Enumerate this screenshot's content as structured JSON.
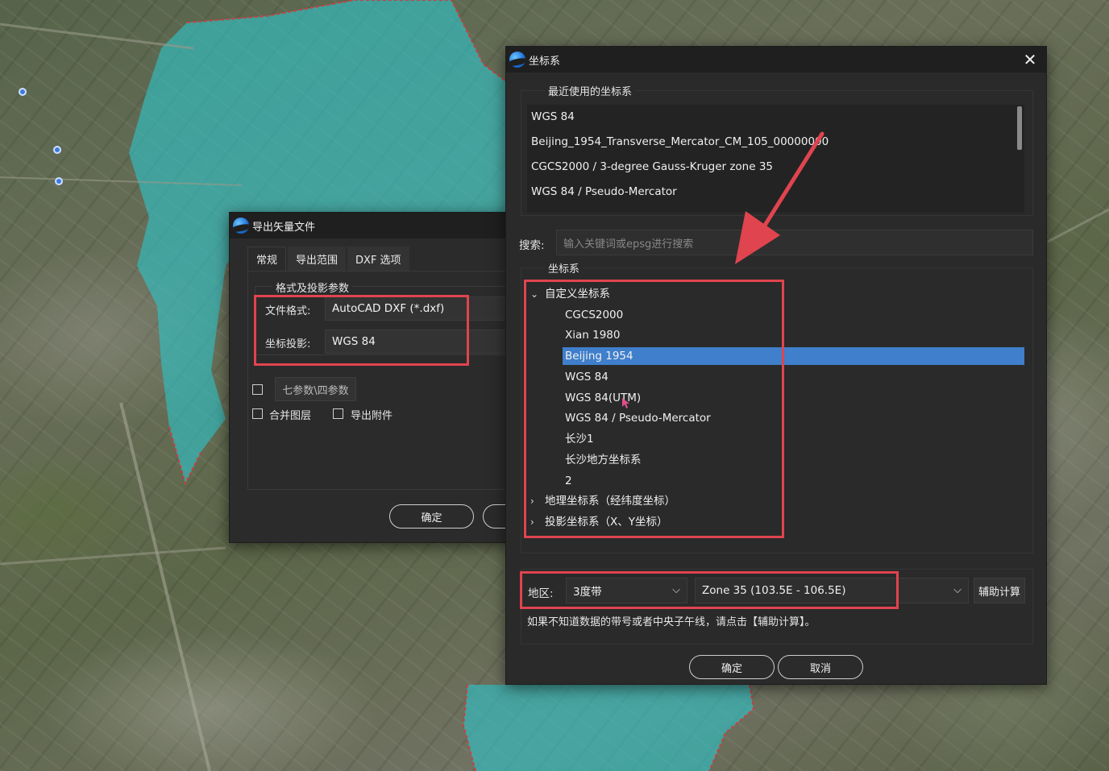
{
  "export_dialog": {
    "title": "导出矢量文件",
    "tabs": [
      "常规",
      "导出范围",
      "DXF 选项"
    ],
    "group_label": "格式及投影参数",
    "format_label": "文件格式:",
    "format_value": "AutoCAD DXF (*.dxf)",
    "projection_label": "坐标投影:",
    "projection_value": "WGS 84",
    "seven_param_button": "七参数\\四参数",
    "merge_layers_label": "合并图层",
    "export_attachments_label": "导出附件",
    "ok_label": "确定"
  },
  "coord_dialog": {
    "title": "坐标系",
    "close_icon": "close-icon",
    "recent_label": "最近使用的坐标系",
    "recent_items": [
      "WGS 84",
      "Beijing_1954_Transverse_Mercator_CM_105_00000000",
      "CGCS2000 / 3-degree Gauss-Kruger zone 35",
      "WGS 84 / Pseudo-Mercator"
    ],
    "search_label": "搜索:",
    "search_placeholder": "输入关键词或epsg进行搜索",
    "tree_label": "坐标系",
    "tree": {
      "custom_group": "自定义坐标系",
      "custom_items": [
        "CGCS2000",
        "Xian 1980",
        "Beijing 1954",
        "WGS 84",
        "WGS 84(UTM)",
        "WGS 84 / Pseudo-Mercator",
        "长沙1",
        "长沙地方坐标系",
        "2"
      ],
      "selected_index": 2,
      "geo_group": "地理坐标系（经纬度坐标）",
      "proj_group": "投影坐标系（X、Y坐标）"
    },
    "region_label": "地区:",
    "zone_type": "3度带",
    "zone_value": "Zone 35 (103.5E - 106.5E)",
    "assist_button": "辅助计算",
    "hint": "如果不知道数据的带号或者中央子午线，请点击【辅助计算】。",
    "ok_label": "确定",
    "cancel_label": "取消"
  },
  "colors": {
    "highlight_box": "#e0444f",
    "selection": "#3f7fcb",
    "flood_overlay": "#2fc4c8"
  }
}
